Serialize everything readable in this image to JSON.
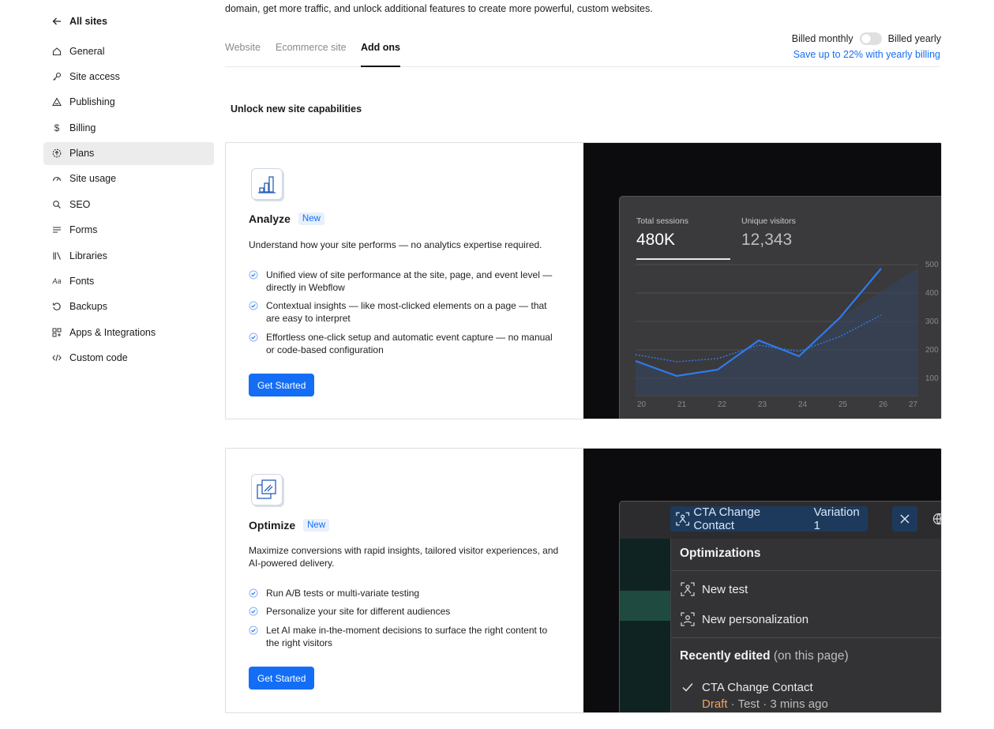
{
  "sidebar": {
    "back_label": "All sites",
    "items": [
      {
        "label": "General",
        "icon": "home-icon"
      },
      {
        "label": "Site access",
        "icon": "key-icon"
      },
      {
        "label": "Publishing",
        "icon": "publish-icon"
      },
      {
        "label": "Billing",
        "icon": "dollar-icon"
      },
      {
        "label": "Plans",
        "icon": "plans-icon",
        "active": true
      },
      {
        "label": "Site usage",
        "icon": "gauge-icon"
      },
      {
        "label": "SEO",
        "icon": "search-icon"
      },
      {
        "label": "Forms",
        "icon": "forms-icon"
      },
      {
        "label": "Libraries",
        "icon": "libraries-icon"
      },
      {
        "label": "Fonts",
        "icon": "fonts-icon"
      },
      {
        "label": "Backups",
        "icon": "backup-icon"
      },
      {
        "label": "Apps & Integrations",
        "icon": "apps-icon"
      },
      {
        "label": "Custom code",
        "icon": "code-icon"
      }
    ]
  },
  "header": {
    "intro_text": "domain, get more traffic, and unlock additional features to create more powerful, custom websites.",
    "tabs": [
      {
        "label": "Website"
      },
      {
        "label": "Ecommerce site"
      },
      {
        "label": "Add ons",
        "active": true
      }
    ],
    "billing": {
      "monthly_label": "Billed monthly",
      "yearly_label": "Billed yearly",
      "save_link": "Save up to 22% with yearly billing",
      "yearly_selected": false
    }
  },
  "section_title": "Unlock new site capabilities",
  "cards": [
    {
      "title": "Analyze",
      "badge": "New",
      "description": "Understand how your site performs — no analytics expertise required.",
      "features": [
        "Unified view of site performance at the site, page, and event level — directly in Webflow",
        "Contextual insights — like most-clicked elements on a page — that are easy to interpret",
        "Effortless one-click setup and automatic event capture — no manual or code-based configuration"
      ],
      "button": "Get Started",
      "preview": {
        "stat1_label": "Total sessions",
        "stat1_value": "480K",
        "stat2_label": "Unique visitors",
        "stat2_value": "12,343",
        "x_ticks": [
          "20",
          "21",
          "22",
          "23",
          "24",
          "25",
          "26",
          "27"
        ],
        "y_ticks": [
          "500",
          "400",
          "300",
          "200",
          "100"
        ]
      }
    },
    {
      "title": "Optimize",
      "badge": "New",
      "description": "Maximize conversions with rapid insights, tailored visitor experiences, and AI-powered delivery.",
      "features": [
        "Run A/B tests or multi-variate testing",
        "Personalize your site for different audiences",
        "Let AI make in-the-moment decisions to surface the right content to the right visitors"
      ],
      "button": "Get Started",
      "preview": {
        "chip_name": "CTA Change Contact",
        "chip_variation": "Variation 1",
        "menu_title": "Optimizations",
        "new_test": "New test",
        "new_personalization": "New personalization",
        "recent_title": "Recently edited",
        "recent_suffix": "(on this page)",
        "recent_item": "CTA Change Contact",
        "recent_status": "Draft",
        "recent_meta": "· Test · 3 mins ago"
      }
    }
  ],
  "colors": {
    "accent": "#146ef5",
    "active_nav_bg": "#ececec",
    "draft": "#f0a35e"
  }
}
